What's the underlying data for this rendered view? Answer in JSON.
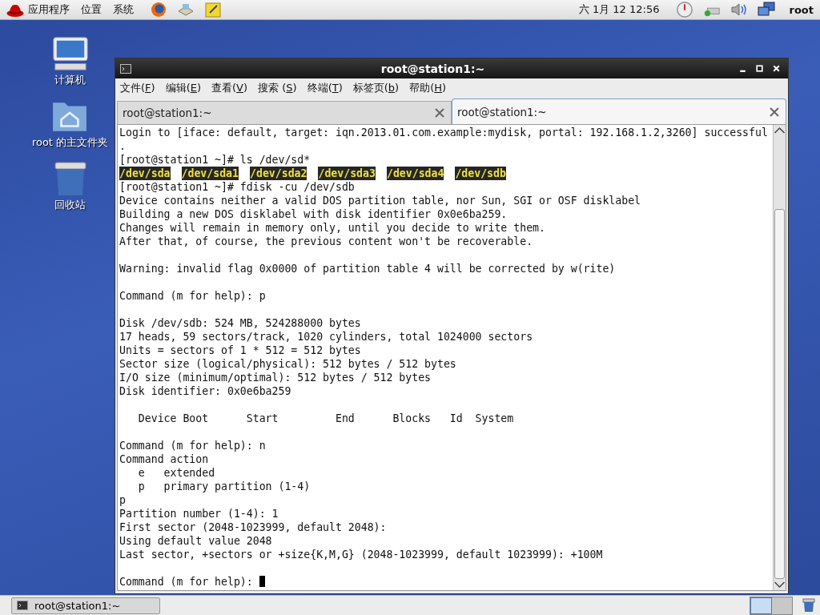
{
  "top_panel": {
    "menus": [
      "应用程序",
      "位置",
      "系统"
    ],
    "clock": "六 1月 12 12:56",
    "user": "root"
  },
  "desktop_icons": [
    {
      "kind": "computer",
      "label": "计算机"
    },
    {
      "kind": "home",
      "label": "root 的主文件夹"
    },
    {
      "kind": "trash",
      "label": "回收站"
    }
  ],
  "window": {
    "title": "root@station1:~",
    "menu": [
      {
        "prefix": "文件(",
        "key": "F",
        "suffix": ")"
      },
      {
        "prefix": "编辑(",
        "key": "E",
        "suffix": ")"
      },
      {
        "prefix": "查看(",
        "key": "V",
        "suffix": ")"
      },
      {
        "prefix": "搜索 (",
        "key": "S",
        "suffix": ")"
      },
      {
        "prefix": "终端(",
        "key": "T",
        "suffix": ")"
      },
      {
        "prefix": "标签页(",
        "key": "b",
        "suffix": ")"
      },
      {
        "prefix": "帮助(",
        "key": "H",
        "suffix": ")"
      }
    ],
    "tabs": [
      {
        "label": "root@station1:~",
        "selected": false
      },
      {
        "label": "root@station1:~",
        "selected": true
      }
    ],
    "terminal": [
      {
        "kind": "text",
        "text": "Login to [iface: default, target: iqn.2013.01.com.example:mydisk, portal: 192.168.1.2,3260] successful"
      },
      {
        "kind": "text",
        "text": "."
      },
      {
        "kind": "text",
        "text": "[root@station1 ~]# ls /dev/sd*"
      },
      {
        "kind": "devices",
        "items": [
          "/dev/sda",
          "/dev/sda1",
          "/dev/sda2",
          "/dev/sda3",
          "/dev/sda4",
          "/dev/sdb"
        ]
      },
      {
        "kind": "text",
        "text": "[root@station1 ~]# fdisk -cu /dev/sdb"
      },
      {
        "kind": "text",
        "text": "Device contains neither a valid DOS partition table, nor Sun, SGI or OSF disklabel"
      },
      {
        "kind": "text",
        "text": "Building a new DOS disklabel with disk identifier 0x0e6ba259."
      },
      {
        "kind": "text",
        "text": "Changes will remain in memory only, until you decide to write them."
      },
      {
        "kind": "text",
        "text": "After that, of course, the previous content won't be recoverable."
      },
      {
        "kind": "blank"
      },
      {
        "kind": "text",
        "text": "Warning: invalid flag 0x0000 of partition table 4 will be corrected by w(rite)"
      },
      {
        "kind": "blank"
      },
      {
        "kind": "text",
        "text": "Command (m for help): p"
      },
      {
        "kind": "blank"
      },
      {
        "kind": "text",
        "text": "Disk /dev/sdb: 524 MB, 524288000 bytes"
      },
      {
        "kind": "text",
        "text": "17 heads, 59 sectors/track, 1020 cylinders, total 1024000 sectors"
      },
      {
        "kind": "text",
        "text": "Units = sectors of 1 * 512 = 512 bytes"
      },
      {
        "kind": "text",
        "text": "Sector size (logical/physical): 512 bytes / 512 bytes"
      },
      {
        "kind": "text",
        "text": "I/O size (minimum/optimal): 512 bytes / 512 bytes"
      },
      {
        "kind": "text",
        "text": "Disk identifier: 0x0e6ba259"
      },
      {
        "kind": "blank"
      },
      {
        "kind": "text",
        "text": "   Device Boot      Start         End      Blocks   Id  System"
      },
      {
        "kind": "blank"
      },
      {
        "kind": "text",
        "text": "Command (m for help): n"
      },
      {
        "kind": "text",
        "text": "Command action"
      },
      {
        "kind": "text",
        "text": "   e   extended"
      },
      {
        "kind": "text",
        "text": "   p   primary partition (1-4)"
      },
      {
        "kind": "text",
        "text": "p"
      },
      {
        "kind": "text",
        "text": "Partition number (1-4): 1"
      },
      {
        "kind": "text",
        "text": "First sector (2048-1023999, default 2048):"
      },
      {
        "kind": "text",
        "text": "Using default value 2048"
      },
      {
        "kind": "text",
        "text": "Last sector, +sectors or +size{K,M,G} (2048-1023999, default 1023999): +100M"
      },
      {
        "kind": "blank"
      },
      {
        "kind": "prompt",
        "text": "Command (m for help): "
      }
    ]
  },
  "taskbar": {
    "tasks": [
      {
        "label": "root@station1:~",
        "selected": false
      }
    ]
  }
}
